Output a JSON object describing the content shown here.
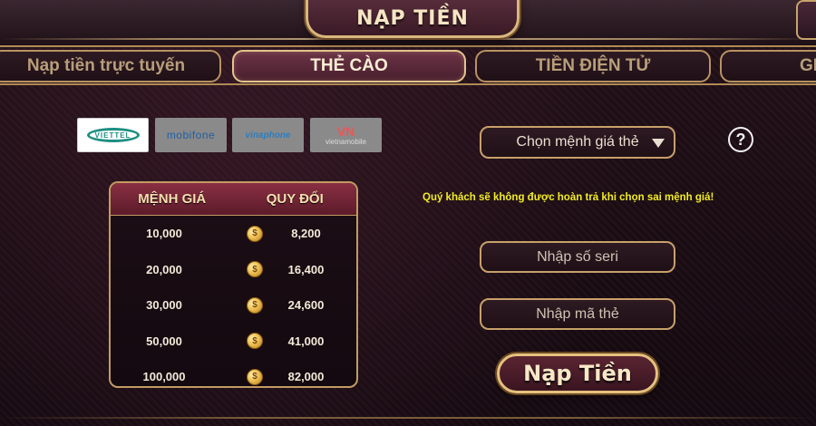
{
  "header": {
    "title": "NẠP TIỀN"
  },
  "tabs": [
    {
      "label": "Nạp tiền trực tuyến",
      "active": false
    },
    {
      "label": "THẺ CÀO",
      "active": true
    },
    {
      "label": "TIỀN ĐIỆN TỬ",
      "active": false
    },
    {
      "label": "GI",
      "active": false
    }
  ],
  "carriers": {
    "viettel": "VIETTEL",
    "mobifone": "mobifone",
    "vinaphone": "vinaphone",
    "vietnamobile": "vietnamobile",
    "vietnamobile_mark": "VN"
  },
  "rate_table": {
    "headers": {
      "denomination": "MỆNH GIÁ",
      "exchange": "QUY ĐỔI"
    },
    "rows": [
      {
        "denomination": "10,000",
        "exchange": "8,200"
      },
      {
        "denomination": "20,000",
        "exchange": "16,400"
      },
      {
        "denomination": "30,000",
        "exchange": "24,600"
      },
      {
        "denomination": "50,000",
        "exchange": "41,000"
      },
      {
        "denomination": "100,000",
        "exchange": "82,000"
      }
    ],
    "coin_symbol": "$"
  },
  "form": {
    "select_placeholder": "Chọn mệnh giá thẻ",
    "help_symbol": "?",
    "notice": "Quý khách sẽ không được hoàn trả khi chọn sai mệnh giá!",
    "serial_placeholder": "Nhập số seri",
    "code_placeholder": "Nhập mã thẻ",
    "submit_label": "Nạp Tiền"
  },
  "colors": {
    "accent_gold": "#d9b67c",
    "notice_yellow": "#f1ed24",
    "active_tab": "#6a3346"
  }
}
